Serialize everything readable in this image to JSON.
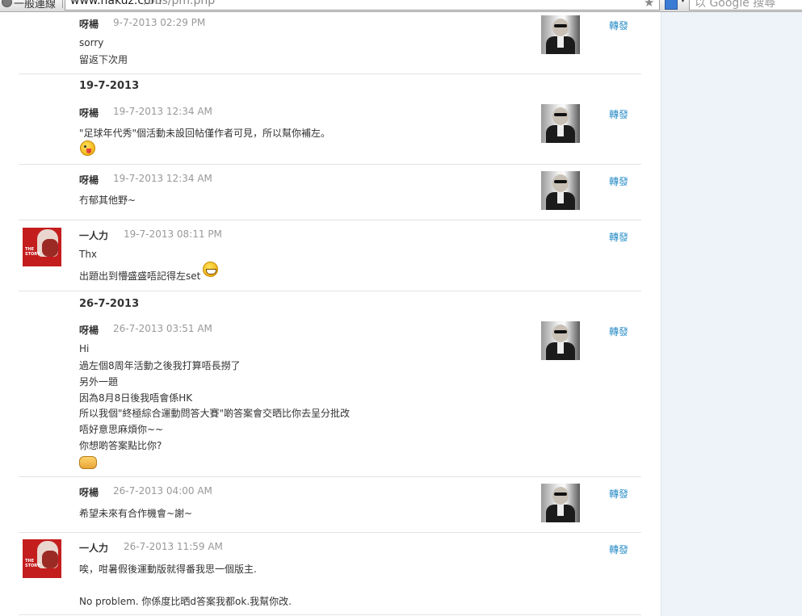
{
  "browser": {
    "bookmark_label": "一般連線",
    "url_domain": "www.hakuz.com",
    "url_path": "/bbs/pm.php",
    "search_placeholder": "以 Google 搜尋"
  },
  "forward_label": "轉發",
  "messages": [
    {
      "author": "呀楊",
      "time": "9-7-2013 02:29 PM",
      "lines": [
        "sorry",
        "留返下次用"
      ]
    },
    {
      "date_heading": "19-7-2013",
      "author": "呀楊",
      "time": "19-7-2013 12:34 AM",
      "lines": [
        "\"足球年代秀\"個活動未設回帖僅作者可見，所以幫你補左。"
      ],
      "emoticon": "tongue-out-emoticon"
    },
    {
      "author": "呀楊",
      "time": "19-7-2013 12:34 AM",
      "lines": [
        "冇郁其他野~"
      ]
    },
    {
      "author": "一人力",
      "time": "19-7-2013 08:11 PM",
      "lines": [
        "Thx",
        "出題出到懵盛盛唔記得左set"
      ],
      "emoticon": "grin-emoticon"
    },
    {
      "date_heading": "26-7-2013",
      "author": "呀楊",
      "time": "26-7-2013 03:51 AM",
      "lines": [
        "Hi",
        "過左個8周年活動之後我打算唔長撈了",
        "另外一題",
        "因為8月8日後我唔會係HK",
        "所以我個\"終極綜合運動問答大賽\"啲答案會交晒比你去呈分批改",
        "唔好意思麻煩你~~",
        "你想啲答案點比你?"
      ],
      "emoticon": "handshake-emoticon"
    },
    {
      "author": "呀楊",
      "time": "26-7-2013 04:00 AM",
      "lines": [
        "希望未來有合作機會~謝~"
      ]
    },
    {
      "author": "一人力",
      "time": "26-7-2013 11:59 AM",
      "lines": [
        "唉，咁暑假後運動版就得番我思一個版主.",
        "",
        "No problem. 你係度比晒d答案我都ok.我幫你改."
      ]
    }
  ]
}
